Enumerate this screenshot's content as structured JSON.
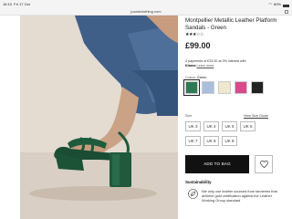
{
  "status_bar": {
    "time": "16:10",
    "day": "Fri 17 Oct",
    "battery": "60%"
  },
  "url_bar": {
    "url": "joanieclothing.com"
  },
  "product": {
    "title": "Montpellier Metallic Leather Platform Sandals - Green",
    "rating_stars": "★★★☆☆",
    "price": "£99.00",
    "klarna": {
      "text": "3 payments of £33.00 at 0% interest with",
      "brand": "Klarna",
      "link": "Learn more"
    },
    "colour": {
      "label": "Colour:",
      "value": "Green",
      "swatches": [
        {
          "name": "Green",
          "color": "#2f7a55",
          "selected": true
        },
        {
          "name": "Blue",
          "color": "#a9bfdc",
          "selected": false
        },
        {
          "name": "Cream",
          "color": "#efe8cf",
          "selected": false
        },
        {
          "name": "Pink",
          "color": "#d94a8c",
          "selected": false
        },
        {
          "name": "Black",
          "color": "#232323",
          "selected": false
        }
      ]
    },
    "size": {
      "label": "Size",
      "guide": "View Size Guide",
      "options": [
        "UK 3",
        "UK 4",
        "UK 5",
        "UK 6",
        "UK 7",
        "UK 8",
        "UK 9"
      ]
    },
    "add_to_bag": "ADD TO BAG",
    "wishlist_icon": "heart-icon",
    "sustainability": {
      "title": "Sustainability",
      "text": "We only use leather sourced from tanneries that achieve gold certification against the Leather Working Group standard"
    }
  }
}
